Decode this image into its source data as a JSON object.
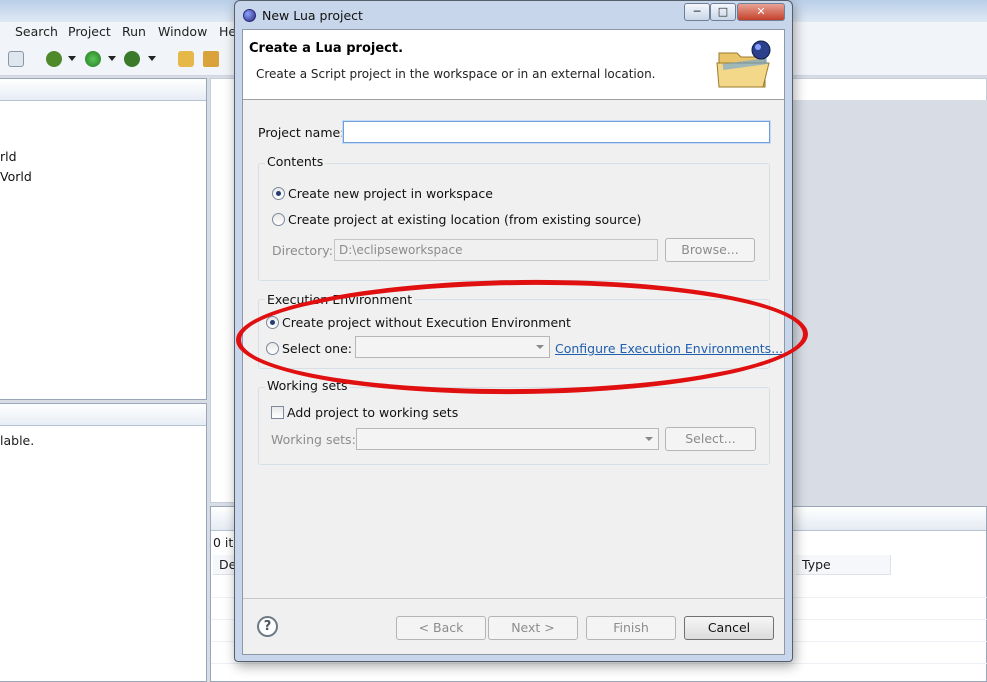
{
  "workbench": {
    "menu": [
      "Search",
      "Project",
      "Run",
      "Window",
      "He"
    ],
    "tree_items": [
      "rld",
      "Vorld"
    ],
    "status_text": "lable.",
    "problems_count": "0 ite",
    "columns": [
      "De",
      "Type"
    ]
  },
  "dialog": {
    "title": "New Lua project",
    "window_buttons": {
      "minimize": "─",
      "maximize": "□",
      "close": "✕"
    },
    "banner": {
      "title": "Create a Lua project.",
      "description": "Create a Script project in the workspace or in an external location.",
      "icon": "folder-wizard-icon"
    },
    "project_name": {
      "label": "Project name:",
      "value": ""
    },
    "contents": {
      "title": "Contents",
      "option_new": "Create new project in workspace",
      "option_existing": "Create project at existing location (from existing source)",
      "directory_label": "Directory:",
      "directory_value": "D:\\eclipseworkspace",
      "browse_label": "Browse..."
    },
    "execution_environment": {
      "title": "Execution Environment",
      "option_without": "Create project without Execution Environment",
      "option_select": "Select one:",
      "configure_link": "Configure Execution Environments..."
    },
    "working_sets": {
      "title": "Working sets",
      "add_label": "Add project to working sets",
      "sets_label": "Working sets:",
      "select_label": "Select..."
    },
    "footer": {
      "help": "?",
      "back": "< Back",
      "next": "Next >",
      "finish": "Finish",
      "cancel": "Cancel"
    },
    "annotation_color": "#e01010"
  }
}
